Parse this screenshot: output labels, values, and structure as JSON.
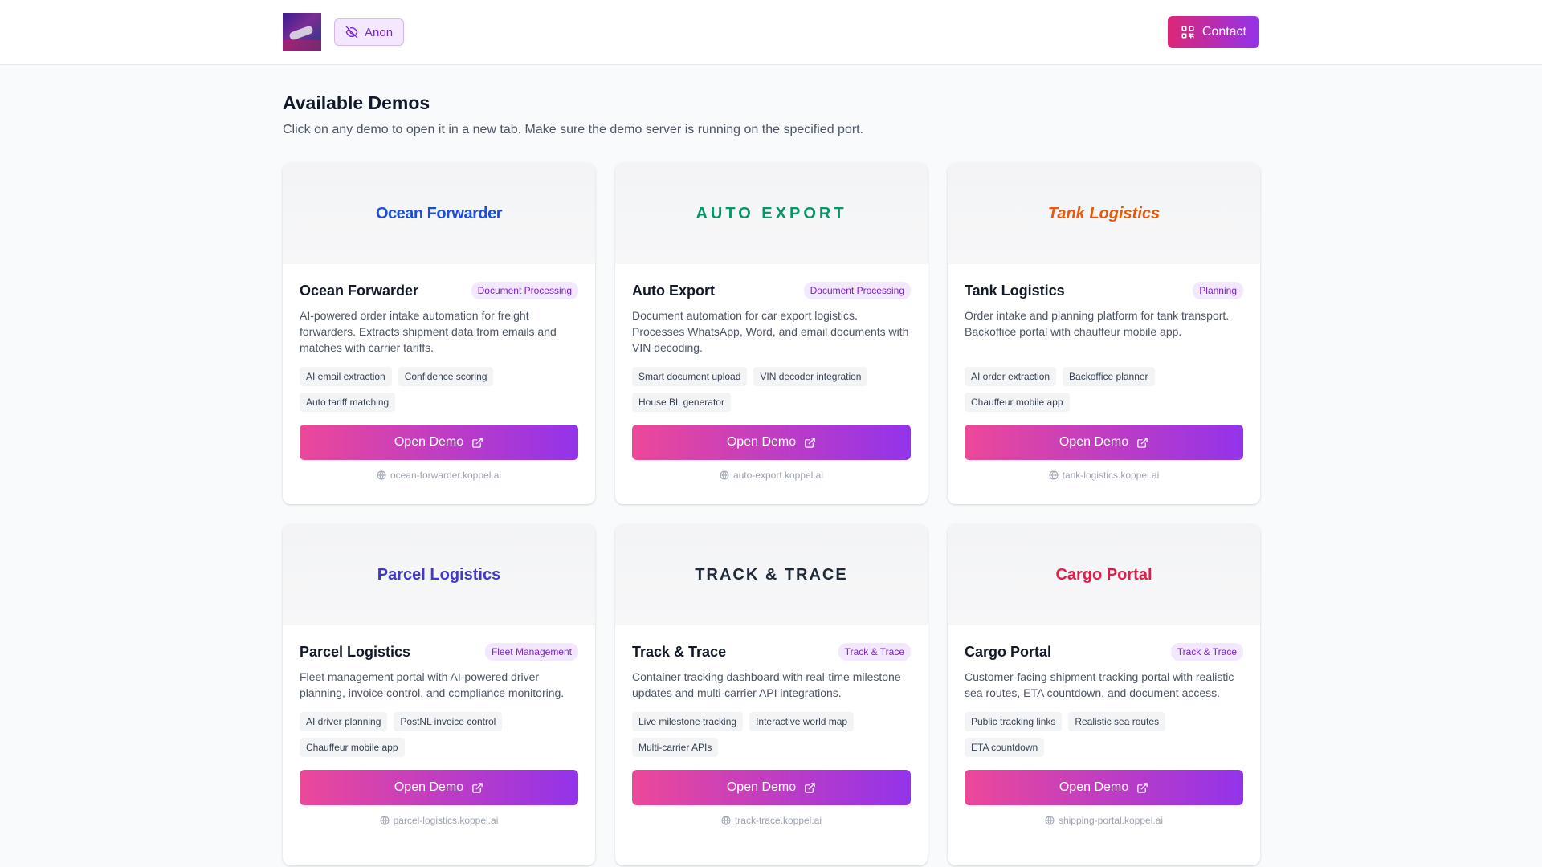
{
  "header": {
    "anon_label": "Anon",
    "contact_label": "Contact"
  },
  "page": {
    "title": "Available Demos",
    "subtitle": "Click on any demo to open it in a new tab. Make sure the demo server is running on the specified port."
  },
  "demos": [
    {
      "banner": "Ocean Forwarder",
      "banner_color": "#1d4ed8",
      "title": "Ocean Forwarder",
      "badge": "Document Processing",
      "description": "AI-powered order intake automation for freight forwarders. Extracts shipment data from emails and matches with carrier tariffs.",
      "tags": [
        "AI email extraction",
        "Confidence scoring",
        "Auto tariff matching"
      ],
      "button": "Open Demo",
      "url": "ocean-forwarder.koppel.ai"
    },
    {
      "banner": "AUTO EXPORT",
      "banner_color": "#059669",
      "title": "Auto Export",
      "badge": "Document Processing",
      "description": "Document automation for car export logistics. Processes WhatsApp, Word, and email documents with VIN decoding.",
      "tags": [
        "Smart document upload",
        "VIN decoder integration",
        "House BL generator"
      ],
      "button": "Open Demo",
      "url": "auto-export.koppel.ai"
    },
    {
      "banner": "Tank Logistics",
      "banner_color": "#ea580c",
      "title": "Tank Logistics",
      "badge": "Planning",
      "description": "Order intake and planning platform for tank transport. Backoffice portal with chauffeur mobile app.",
      "tags": [
        "AI order extraction",
        "Backoffice planner",
        "Chauffeur mobile app"
      ],
      "button": "Open Demo",
      "url": "tank-logistics.koppel.ai"
    },
    {
      "banner": "Parcel Logistics",
      "banner_color": "#4338ca",
      "title": "Parcel Logistics",
      "badge": "Fleet Management",
      "description": "Fleet management portal with AI-powered driver planning, invoice control, and compliance monitoring.",
      "tags": [
        "AI driver planning",
        "PostNL invoice control",
        "Chauffeur mobile app"
      ],
      "button": "Open Demo",
      "url": "parcel-logistics.koppel.ai"
    },
    {
      "banner": "TRACK & TRACE",
      "banner_color": "#1f2937",
      "title": "Track & Trace",
      "badge": "Track & Trace",
      "description": "Container tracking dashboard with real-time milestone updates and multi-carrier API integrations.",
      "tags": [
        "Live milestone tracking",
        "Interactive world map",
        "Multi-carrier APIs"
      ],
      "button": "Open Demo",
      "url": "track-trace.koppel.ai"
    },
    {
      "banner": "Cargo Portal",
      "banner_color": "#e11d48",
      "title": "Cargo Portal",
      "badge": "Track & Trace",
      "description": "Customer-facing shipment tracking portal with realistic sea routes, ETA countdown, and document access.",
      "tags": [
        "Public tracking links",
        "Realistic sea routes",
        "ETA countdown"
      ],
      "button": "Open Demo",
      "url": "shipping-portal.koppel.ai"
    }
  ]
}
